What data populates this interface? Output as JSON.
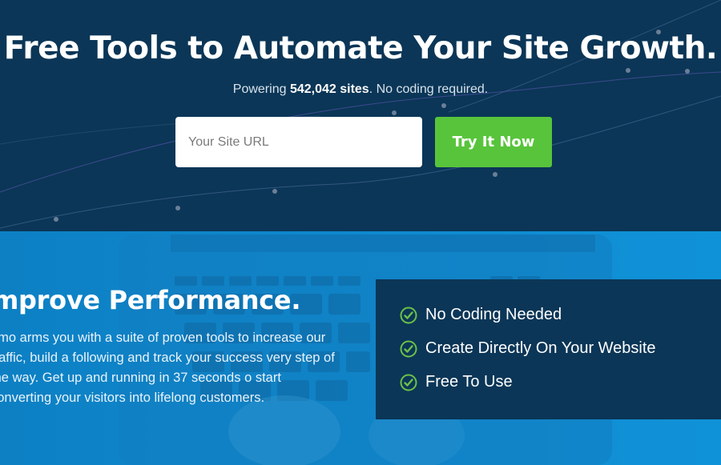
{
  "hero": {
    "title": "Free Tools to Automate Your Site Growth.",
    "subtitle_prefix": "Powering ",
    "subtitle_count": "542,042 sites",
    "subtitle_suffix": ". No coding required.",
    "url_placeholder": "Your Site URL",
    "cta_label": "Try It Now"
  },
  "feature": {
    "title": "mprove Performance.",
    "description": "umo arms you with a suite of proven tools to increase our traffic, build a following and track your success very step of the way. Get up and running in 37 seconds o start converting your visitors into lifelong customers.",
    "checklist": [
      {
        "icon": "check-circle-icon",
        "label": "No Coding Needed"
      },
      {
        "icon": "check-circle-icon",
        "label": "Create Directly On Your Website"
      },
      {
        "icon": "check-circle-icon",
        "label": "Free To Use"
      }
    ]
  },
  "colors": {
    "hero_bg": "#0b3657",
    "feature_bg": "#0e82c7",
    "cta_green": "#58c43b",
    "check_green": "#6cc04a"
  }
}
